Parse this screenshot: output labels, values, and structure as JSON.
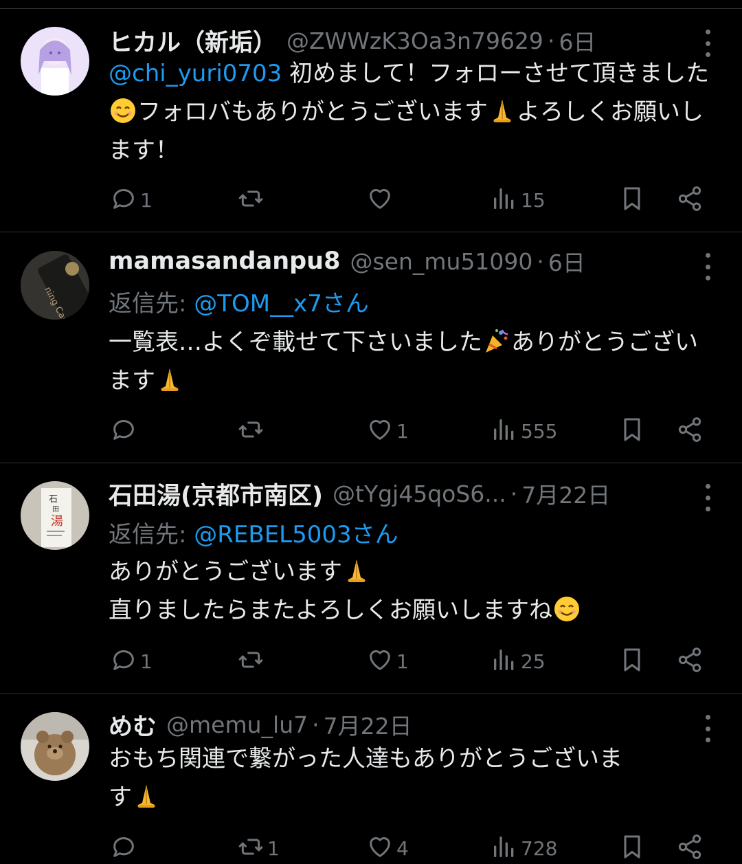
{
  "posts": [
    {
      "name": "ヒカル（新垢）",
      "handle": "@ZWWzK3Oa3n79629",
      "dot": "·",
      "time": "6日",
      "reply_prefix": "",
      "reply_to": "",
      "reply_suffix": "",
      "mention": "@chi_yuri0703",
      "text": [
        " 初めまして！フォローさせて頂きました",
        "フォロバもありがとうございます",
        "よろしくお願いします！"
      ],
      "emojis": [
        "smiling-face",
        "folded-hands"
      ],
      "counts": {
        "reply": "1",
        "retweet": "",
        "like": "",
        "views": "15"
      },
      "avatar_colors": [
        "#e8dcf8",
        "#b9a3e6"
      ]
    },
    {
      "name": "mamasandanpu8",
      "handle": "@sen_mu51090",
      "dot": "·",
      "time": "6日",
      "reply_prefix": "返信先: ",
      "reply_to": "@TOM__x7",
      "reply_suffix": "さん",
      "text": [
        "一覧表…よくぞ載せて下さいました",
        "ありがとうございます"
      ],
      "emojis": [
        "party-popper",
        "folded-hands"
      ],
      "counts": {
        "reply": "",
        "retweet": "",
        "like": "1",
        "views": "555"
      },
      "avatar_colors": [
        "#3b3a36",
        "#1d1c1a"
      ]
    },
    {
      "name": "石田湯(京都市南区)",
      "handle": "@tYgj45qoS6...",
      "dot": "·",
      "time": "7月22日",
      "reply_prefix": "返信先: ",
      "reply_to": "@REBEL5003",
      "reply_suffix": "さん",
      "text": [
        "ありがとうございます",
        "直りましたらまたよろしくお願いしますね"
      ],
      "emojis": [
        "folded-hands",
        "smiling-face"
      ],
      "counts": {
        "reply": "1",
        "retweet": "",
        "like": "1",
        "views": "25"
      },
      "avatar_colors": [
        "#f1efe9",
        "#c9c4ba"
      ]
    },
    {
      "name": "めむ",
      "handle": "@memu_lu7",
      "dot": "·",
      "time": "7月22日",
      "reply_prefix": "",
      "reply_to": "",
      "reply_suffix": "",
      "text": [
        "おもち関連で繋がった人達もありがとうございま",
        "す"
      ],
      "emojis": [
        "folded-hands"
      ],
      "counts": {
        "reply": "",
        "retweet": "1",
        "like": "4",
        "views": "728"
      },
      "avatar_colors": [
        "#9a8f84",
        "#c4b4a0"
      ]
    }
  ],
  "colors": {
    "background": "#000000",
    "text": "#e7e9ea",
    "muted": "#71767b",
    "link": "#1d9bf0",
    "divider": "#2f3336"
  },
  "icons": [
    "reply-icon",
    "retweet-icon",
    "like-icon",
    "views-icon",
    "bookmark-icon",
    "share-icon",
    "more-icon"
  ]
}
